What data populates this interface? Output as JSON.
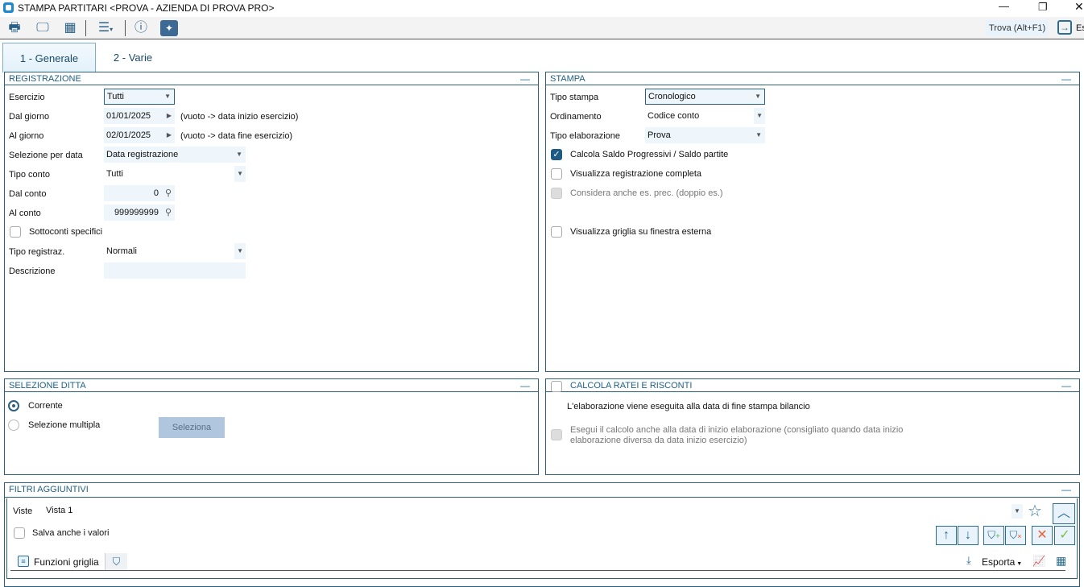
{
  "window": {
    "title": "STAMPA PARTITARI <PROVA - AZIENDA DI PROVA PRO>",
    "find": "Trova (Alt+F1)",
    "exit": "Es"
  },
  "tabs": [
    {
      "label": "1 - Generale"
    },
    {
      "label": "2 - Varie"
    }
  ],
  "registrazione": {
    "title": "REGISTRAZIONE",
    "esercizio_label": "Esercizio",
    "esercizio": "Tutti",
    "dal_giorno_label": "Dal giorno",
    "dal_giorno": "01/01/2025",
    "dal_hint": "(vuoto -> data inizio esercizio)",
    "al_giorno_label": "Al giorno",
    "al_giorno": "02/01/2025",
    "al_hint": "(vuoto -> data fine esercizio)",
    "sel_data_label": "Selezione per data",
    "sel_data": "Data registrazione",
    "tipo_conto_label": "Tipo conto",
    "tipo_conto": "Tutti",
    "dal_conto_label": "Dal conto",
    "dal_conto": "0",
    "al_conto_label": "Al conto",
    "al_conto": "999999999",
    "sottoconti_label": "Sottoconti specifici",
    "tipo_reg_label": "Tipo registraz.",
    "tipo_reg": "Normali",
    "descrizione_label": "Descrizione",
    "descrizione": ""
  },
  "stampa": {
    "title": "STAMPA",
    "tipo_stampa_label": "Tipo stampa",
    "tipo_stampa": "Cronologico",
    "ordinamento_label": "Ordinamento",
    "ordinamento": "Codice conto",
    "tipo_elab_label": "Tipo elaborazione",
    "tipo_elab": "Prova",
    "calcola_saldo": "Calcola Saldo Progressivi / Saldo partite",
    "visualizza_reg": "Visualizza registrazione completa",
    "considera": "Considera anche es. prec. (doppio es.)",
    "griglia_esterna": "Visualizza griglia su finestra esterna"
  },
  "selezione_ditta": {
    "title": "SELEZIONE DITTA",
    "corrente": "Corrente",
    "multipla": "Selezione multipla",
    "seleziona": "Seleziona"
  },
  "ratei": {
    "title": "CALCOLA RATEI E RISCONTI",
    "info": "L'elaborazione viene eseguita alla data di fine stampa bilancio",
    "esegui_1": "Esegui il calcolo anche alla data di inizio elaborazione (consigliato quando data inizio",
    "esegui_2": "elaborazione diversa da data inizio esercizio)"
  },
  "filtri": {
    "title": "FILTRI AGGIUNTIVI",
    "viste_label": "Viste",
    "vista": "Vista 1",
    "salva": "Salva anche i valori",
    "funzioni": "Funzioni griglia",
    "esporta": "Esporta"
  }
}
